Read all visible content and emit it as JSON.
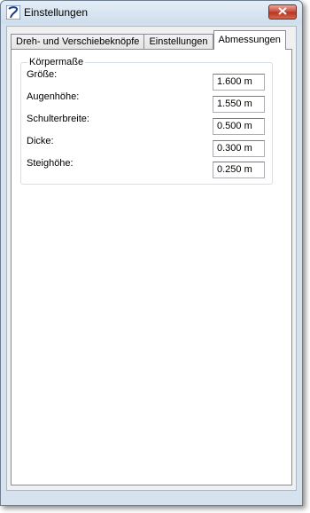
{
  "window": {
    "title": "Einstellungen"
  },
  "tabs": [
    {
      "label": "Dreh- und Verschiebeknöpfe",
      "active": false
    },
    {
      "label": "Einstellungen",
      "active": false
    },
    {
      "label": "Abmessungen",
      "active": true
    }
  ],
  "group": {
    "title": "Körpermaße",
    "rows": [
      {
        "label": "Größe:",
        "value": "1.600 m"
      },
      {
        "label": "Augenhöhe:",
        "value": "1.550 m"
      },
      {
        "label": "Schulterbreite:",
        "value": "0.500 m"
      },
      {
        "label": "Dicke:",
        "value": "0.300 m"
      },
      {
        "label": "Steighöhe:",
        "value": "0.250 m"
      }
    ]
  },
  "icons": {
    "app": "app-logo-icon",
    "close": "close-icon"
  },
  "colors": {
    "close_button": "#c7483a",
    "frame": "#d6e3ef",
    "panel": "#ffffff"
  }
}
